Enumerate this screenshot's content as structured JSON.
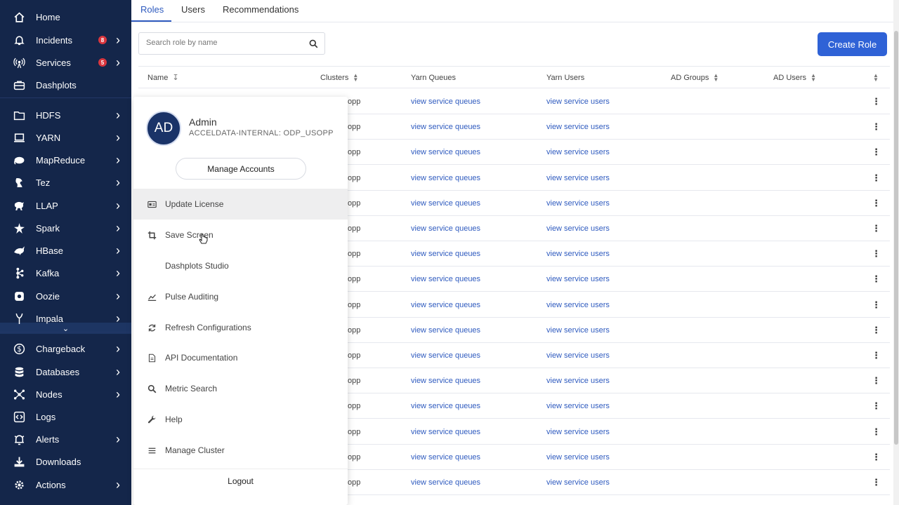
{
  "sidebar": {
    "items": [
      {
        "label": "Home",
        "icon": "home-icon",
        "badge": null,
        "chevron": false
      },
      {
        "label": "Incidents",
        "icon": "bell-icon",
        "badge": "8",
        "chevron": true
      },
      {
        "label": "Services",
        "icon": "antenna-icon",
        "badge": "5",
        "chevron": true
      },
      {
        "label": "Dashplots",
        "icon": "briefcase-icon",
        "badge": null,
        "chevron": false
      },
      {
        "label": "HDFS",
        "icon": "folder-icon",
        "badge": null,
        "chevron": true
      },
      {
        "label": "YARN",
        "icon": "laptop-icon",
        "badge": null,
        "chevron": true
      },
      {
        "label": "MapReduce",
        "icon": "elephant-icon",
        "badge": null,
        "chevron": true
      },
      {
        "label": "Tez",
        "icon": "tez-icon",
        "badge": null,
        "chevron": true
      },
      {
        "label": "LLAP",
        "icon": "llap-icon",
        "badge": null,
        "chevron": true
      },
      {
        "label": "Spark",
        "icon": "spark-icon",
        "badge": null,
        "chevron": true
      },
      {
        "label": "HBase",
        "icon": "orca-icon",
        "badge": null,
        "chevron": true
      },
      {
        "label": "Kafka",
        "icon": "kafka-icon",
        "badge": null,
        "chevron": true
      },
      {
        "label": "Oozie",
        "icon": "oozie-icon",
        "badge": null,
        "chevron": true
      },
      {
        "label": "Impala",
        "icon": "impala-icon",
        "badge": null,
        "chevron": true
      },
      {
        "label": "Chargeback",
        "icon": "dollar-icon",
        "badge": null,
        "chevron": true
      },
      {
        "label": "Databases",
        "icon": "database-icon",
        "badge": null,
        "chevron": true
      },
      {
        "label": "Nodes",
        "icon": "nodes-icon",
        "badge": null,
        "chevron": true
      },
      {
        "label": "Logs",
        "icon": "code-icon",
        "badge": null,
        "chevron": false
      },
      {
        "label": "Alerts",
        "icon": "alert-icon",
        "badge": null,
        "chevron": true
      },
      {
        "label": "Downloads",
        "icon": "download-icon",
        "badge": null,
        "chevron": false
      },
      {
        "label": "Actions",
        "icon": "gear-icon",
        "badge": null,
        "chevron": true
      }
    ]
  },
  "tabs": [
    "Roles",
    "Users",
    "Recommendations"
  ],
  "search": {
    "placeholder": "Search role by name"
  },
  "create_button": "Create Role",
  "table": {
    "headers": [
      "Name",
      "Clusters",
      "Yarn Queues",
      "Yarn Users",
      "AD Groups",
      "AD Users"
    ],
    "rows": [
      {
        "cluster": "opp",
        "queues": "view service queues",
        "users": "view service users"
      },
      {
        "cluster": "opp",
        "queues": "view service queues",
        "users": "view service users"
      },
      {
        "cluster": "opp",
        "queues": "view service queues",
        "users": "view service users"
      },
      {
        "cluster": "opp",
        "queues": "view service queues",
        "users": "view service users"
      },
      {
        "cluster": "opp",
        "queues": "view service queues",
        "users": "view service users"
      },
      {
        "cluster": "opp",
        "queues": "view service queues",
        "users": "view service users"
      },
      {
        "cluster": "opp",
        "queues": "view service queues",
        "users": "view service users"
      },
      {
        "cluster": "opp",
        "queues": "view service queues",
        "users": "view service users"
      },
      {
        "cluster": "opp",
        "queues": "view service queues",
        "users": "view service users"
      },
      {
        "cluster": "opp",
        "queues": "view service queues",
        "users": "view service users"
      },
      {
        "cluster": "opp",
        "queues": "view service queues",
        "users": "view service users"
      },
      {
        "cluster": "opp",
        "queues": "view service queues",
        "users": "view service users"
      },
      {
        "cluster": "opp",
        "queues": "view service queues",
        "users": "view service users"
      },
      {
        "cluster": "opp",
        "queues": "view service queues",
        "users": "view service users"
      },
      {
        "cluster": "opp",
        "queues": "view service queues",
        "users": "view service users"
      },
      {
        "cluster": "opp",
        "queues": "view service queues",
        "users": "view service users"
      }
    ]
  },
  "user_menu": {
    "avatar_initials": "AD",
    "name": "Admin",
    "org": "ACCELDATA-INTERNAL: ODP_USOPP",
    "manage_accounts": "Manage Accounts",
    "items": [
      {
        "label": "Update License",
        "icon": "license-icon"
      },
      {
        "label": "Save Screen",
        "icon": "crop-icon"
      },
      {
        "label": "Dashplots Studio",
        "icon": "briefcase-icon"
      },
      {
        "label": "Pulse Auditing",
        "icon": "chart-line-icon"
      },
      {
        "label": "Refresh Configurations",
        "icon": "refresh-icon"
      },
      {
        "label": "API Documentation",
        "icon": "document-icon"
      },
      {
        "label": "Metric Search",
        "icon": "search-icon"
      },
      {
        "label": "Help",
        "icon": "wrench-icon"
      },
      {
        "label": "Manage Cluster",
        "icon": "menu-icon"
      }
    ],
    "logout": "Logout"
  },
  "colors": {
    "sidebar_bg": "#14264a",
    "accent": "#2f62d6",
    "link": "#2f5bbf",
    "badge": "#d9363e"
  }
}
